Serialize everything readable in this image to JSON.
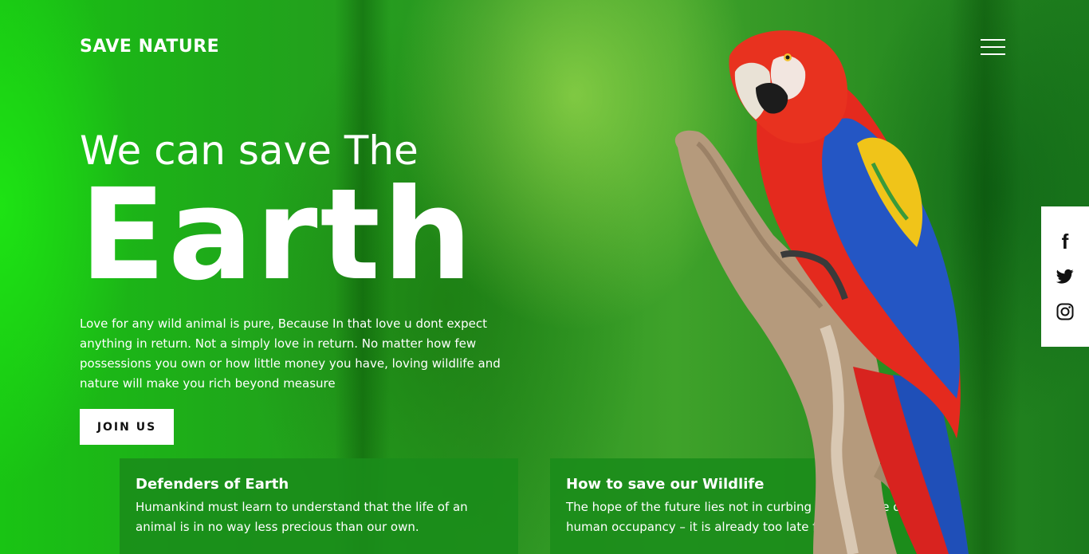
{
  "header": {
    "brand": "SAVE NATURE"
  },
  "hero": {
    "subtitle": "We can save The",
    "title": "Earth",
    "description": "Love for any wild animal is pure, Because In that love u dont expect anything in return. Not a simply love in return. No matter how few possessions you own or how little money you have, loving wildlife and nature will make you rich beyond measure",
    "cta_label": "JOIN US"
  },
  "cards": [
    {
      "title": "Defenders of Earth",
      "text": "Humankind must learn to understand that the life of an animal is in no way less precious than our own."
    },
    {
      "title": "How to save our Wildlife",
      "text": "The hope of the future lies not in curbing the increase of human occupancy – it is already too late for that"
    }
  ],
  "social": {
    "icons": [
      "facebook-icon",
      "twitter-icon",
      "instagram-icon"
    ],
    "facebook_glyph": "f"
  },
  "colors": {
    "background_green": "#1f9a1a",
    "card_green": "#1a8c1a",
    "text": "#ffffff",
    "button_bg": "#ffffff",
    "button_text": "#111111"
  }
}
